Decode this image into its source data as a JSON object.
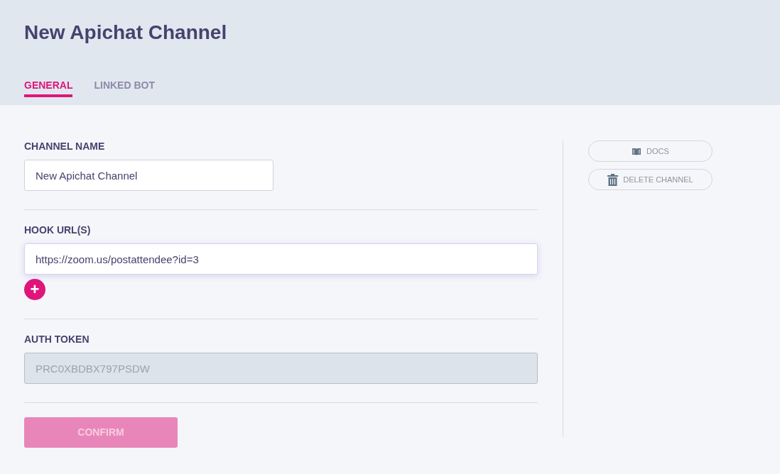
{
  "title": "New Apichat Channel",
  "tabs": [
    {
      "label": "GENERAL",
      "selected": true
    },
    {
      "label": "LINKED BOT",
      "selected": false
    }
  ],
  "fields": [
    {
      "kind": "text",
      "label": "CHANNEL NAME",
      "value": "New Apichat Channel",
      "disabled": false
    },
    {
      "kind": "hooks",
      "label": "HOOK URL(S)",
      "values": [
        "https://zoom.us/postattendee?id=3"
      ],
      "add_button": "+"
    },
    {
      "kind": "text",
      "label": "AUTH TOKEN",
      "value": "PRC0XBDBX797PSDW",
      "disabled": true
    }
  ],
  "confirm": {
    "label": "CONFIRM",
    "disabled": true
  },
  "side_buttons": [
    {
      "kind": "docs",
      "label": "DOCS"
    },
    {
      "kind": "delete",
      "label": "DELETE CHANNEL"
    }
  ]
}
